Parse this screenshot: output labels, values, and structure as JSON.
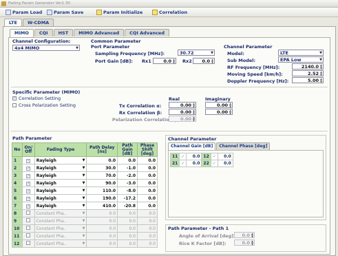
{
  "window": {
    "title": "Fading Param Generator Ver1.30"
  },
  "toolbar": {
    "param_load": "Param Load",
    "param_save": "Param Save",
    "param_initialize": "Param Initialize",
    "correlation": "Correlation"
  },
  "top_tabs": [
    "LTE",
    "W-CDMA"
  ],
  "sub_tabs": [
    "MIMO",
    "CQI",
    "HST",
    "MIMO Advanced",
    "CQI Advanced"
  ],
  "channel_config": {
    "label": "Channel Configuration:",
    "value": "4x4 MIMO"
  },
  "common": {
    "title": "Common Parameter",
    "port_param": "Port Parameter",
    "sampling_label": "Sampling Frequency [MHz]:",
    "sampling_value": "30.72",
    "port_gain_label": "Port Gain [dB]:",
    "rx1_label": "Rx1",
    "rx1_value": "0.0",
    "rx2_label": "Rx2",
    "rx2_value": "0.0"
  },
  "channel_param": {
    "title": "Channel Parameter",
    "model_label": "Model:",
    "model_value": "LTE",
    "submodel_label": "Sub Model:",
    "submodel_value": "EPA Low",
    "rf_label": "RF Frequency [MHz]:",
    "rf_value": "2140.0",
    "speed_label": "Moving Speed [km/h]:",
    "speed_value": "2.52",
    "doppler_label": "Doppler Frequency [Hz]:",
    "doppler_value": "5.00"
  },
  "specific": {
    "title": "Specific Parameter (MIMO)",
    "corr_setting": "Correlation Setting",
    "cross_pol": "Cross Polarization Setting",
    "real_label": "Real",
    "imag_label": "Imaginary",
    "tx_label": "Tx Correlation α:",
    "tx_real": "0.00",
    "tx_imag": "0.00",
    "rx_label": "Rx Correlation β:",
    "rx_real": "0.00",
    "rx_imag": "0.00",
    "pol_label": "Polarization Correlation γ:",
    "pol_real": "0.00"
  },
  "path_param": {
    "title": "Path Parameter",
    "headers": [
      "No",
      "On/ Off",
      "Fading Type",
      "Path Delay [ns]",
      "Path Gain [dB]",
      "Phase Shift [deg]"
    ],
    "rows": [
      {
        "no": "1",
        "on": true,
        "type": "Rayleigh",
        "delay": "0.0",
        "gain": "0.0",
        "phase": "0.0"
      },
      {
        "no": "2",
        "on": true,
        "type": "Rayleigh",
        "delay": "30.0",
        "gain": "-1.0",
        "phase": "0.0"
      },
      {
        "no": "3",
        "on": true,
        "type": "Rayleigh",
        "delay": "70.0",
        "gain": "-2.0",
        "phase": "0.0"
      },
      {
        "no": "4",
        "on": true,
        "type": "Rayleigh",
        "delay": "90.0",
        "gain": "-3.0",
        "phase": "0.0"
      },
      {
        "no": "5",
        "on": true,
        "type": "Rayleigh",
        "delay": "110.0",
        "gain": "-8.0",
        "phase": "0.0"
      },
      {
        "no": "6",
        "on": true,
        "type": "Rayleigh",
        "delay": "190.0",
        "gain": "-17.2",
        "phase": "0.0"
      },
      {
        "no": "7",
        "on": true,
        "type": "Rayleigh",
        "delay": "410.0",
        "gain": "-20.8",
        "phase": "0.0"
      },
      {
        "no": "8",
        "on": false,
        "type": "Constant Pha..",
        "delay": "0.0",
        "gain": "0.0",
        "phase": "0.0"
      },
      {
        "no": "9",
        "on": false,
        "type": "Constant Pha..",
        "delay": "0.0",
        "gain": "0.0",
        "phase": "0.0"
      },
      {
        "no": "10",
        "on": false,
        "type": "Constant Pha..",
        "delay": "0.0",
        "gain": "0.0",
        "phase": "0.0"
      },
      {
        "no": "11",
        "on": false,
        "type": "Constant Pha..",
        "delay": "0.0",
        "gain": "0.0",
        "phase": "0.0"
      },
      {
        "no": "12",
        "on": false,
        "type": "Constant Pha..",
        "delay": "0.0",
        "gain": "0.0",
        "phase": "0.0"
      }
    ]
  },
  "channel_parameter2": {
    "title": "Channel Parameter",
    "tab_gain": "Channel Gain [dB]",
    "tab_phase": "Channel Phase [deg]",
    "cells": [
      {
        "id": "11",
        "value": "0.0"
      },
      {
        "id": "12",
        "value": "0.0"
      },
      {
        "id": "21",
        "value": "0.0"
      },
      {
        "id": "22",
        "value": "0.0"
      }
    ]
  },
  "path1": {
    "title": "Path Parameter - Path 1",
    "aoa_label": "Angle of Arrival [deg]:",
    "aoa_value": "0.0",
    "rice_label": "Rice K Factor [dB]:",
    "rice_value": "0.0"
  }
}
